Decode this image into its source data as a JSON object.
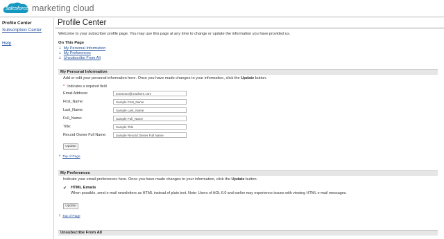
{
  "header": {
    "logo_text": "salesforce",
    "brand": "marketing cloud",
    "accent": "#1798c1"
  },
  "sidebar": {
    "items": [
      {
        "label": "Profile Center",
        "active": true
      },
      {
        "label": "Subscription Center",
        "active": false
      },
      {
        "label": "Help",
        "active": false
      }
    ]
  },
  "main": {
    "title": "Profile Center",
    "welcome": "Welcome to your subscriber profile page. You may use this page at any time to change or update the information you have provided us.",
    "on_this_page": {
      "title": "On This Page",
      "links": [
        "My Personal Information",
        "My Preferences",
        "Unsubscribe From All"
      ]
    },
    "personal": {
      "title": "My Personal Information",
      "intro_before": "Add or edit your personal information here. Once you have made changes to your information, click the ",
      "intro_bold": "Update",
      "intro_after": " button.",
      "required_note": "Indicates a required field",
      "fields": [
        {
          "label": "Email Address:",
          "value": "someone@nowhere.com"
        },
        {
          "label": "First_Name:",
          "value": "Sample First_Name"
        },
        {
          "label": "Last_Name:",
          "value": "Sample Last_Name"
        },
        {
          "label": "Full_Name:",
          "value": "Sample Full_Name"
        },
        {
          "label": "Title:",
          "value": "Sample Title"
        },
        {
          "label": "Record Owner Full Name:",
          "value": "Sample Record Owner Full Name"
        }
      ],
      "update_label": "Update",
      "top_link": "Top of Page"
    },
    "preferences": {
      "title": "My Preferences",
      "intro_before": "Indicate your email preferences here. Once you have made changes to your information, click the ",
      "intro_bold": "Update",
      "intro_after": " button.",
      "checkbox_glyph": "✔",
      "html_title": "HTML Emails",
      "html_desc": "When possible, send e-mail newsletters as HTML instead of plain text. Note: Users of AOL 6.0 and earlier may experience issues with viewing HTML e-mail messages.",
      "update_label": "Update",
      "top_link": "Top of Page"
    },
    "unsubscribe": {
      "title": "Unsubscribe From All"
    }
  }
}
